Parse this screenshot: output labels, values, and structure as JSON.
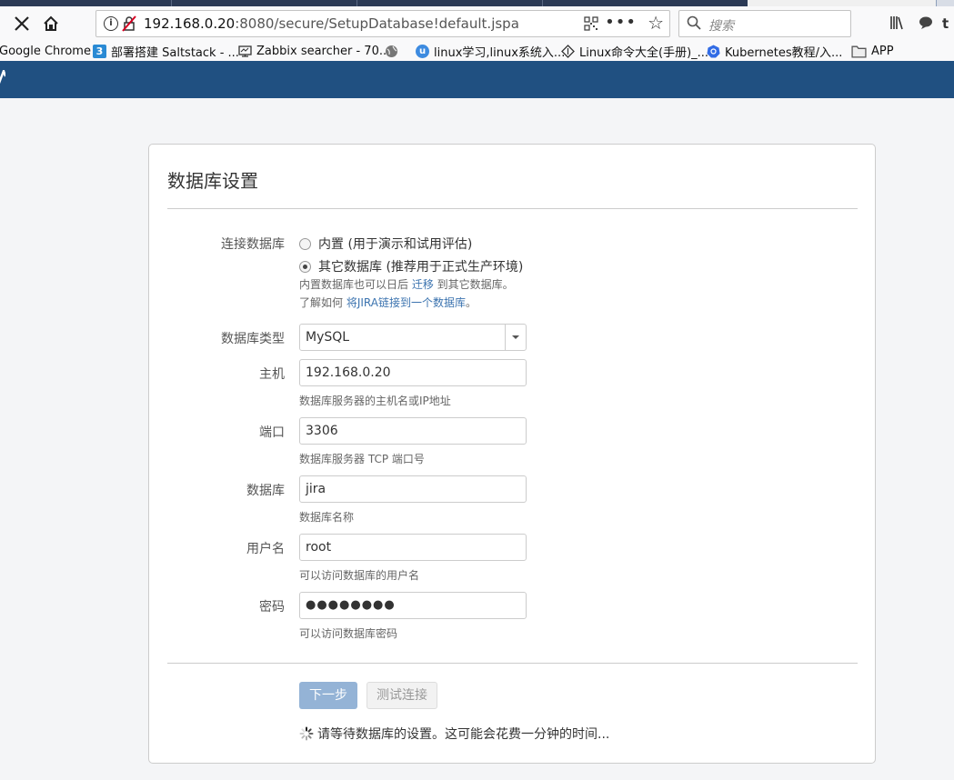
{
  "browser": {
    "url_host": "192.168.0.20",
    "url_rest": ":8080/secure/SetupDatabase!default.jspa",
    "search_placeholder": "搜索",
    "bookmarks": [
      {
        "label": "Google Chrome",
        "icon": "none"
      },
      {
        "label": "部署搭建 Saltstack - ...",
        "icon": "blue-3-icon"
      },
      {
        "label": "Zabbix searcher - 70...",
        "icon": "monitor-icon"
      },
      {
        "label": "",
        "icon": "globe-icon"
      },
      {
        "label": "linux学习,linux系统入...",
        "icon": "blue-circle-icon"
      },
      {
        "label": "Linux命令大全(手册)_...",
        "icon": "diamond-icon"
      },
      {
        "label": "Kubernetes教程/入...",
        "icon": "kubernetes-icon"
      },
      {
        "label": "APP",
        "icon": "folder-icon"
      }
    ]
  },
  "colors": {
    "header": "#205081",
    "primary_button": "#94b3d6",
    "link": "#3b73af"
  },
  "setup": {
    "title": "数据库设置",
    "connection_label": "连接数据库",
    "option_builtin": "内置 (用于演示和试用评估)",
    "option_other": "其它数据库 (推荐用于正式生产环境)",
    "selected_option": "other",
    "note1_before": "内置数据库也可以日后 ",
    "note1_link": "迁移",
    "note1_after": " 到其它数据库。",
    "note2_before": "了解如何 ",
    "note2_link": "将JIRA链接到一个数据库",
    "note2_after": "。",
    "db_type_label": "数据库类型",
    "db_type_value": "MySQL",
    "host_label": "主机",
    "host_value": "192.168.0.20",
    "host_hint": "数据库服务器的主机名或IP地址",
    "port_label": "端口",
    "port_value": "3306",
    "port_hint": "数据库服务器 TCP 端口号",
    "database_label": "数据库",
    "database_value": "jira",
    "database_hint": "数据库名称",
    "username_label": "用户名",
    "username_value": "root",
    "username_hint": "可以访问数据库的用户名",
    "password_label": "密码",
    "password_value": "●●●●●●●●",
    "password_hint": "可以访问数据库密码",
    "next_button": "下一步",
    "test_button": "测试连接",
    "wait_message": "请等待数据库的设置。这可能会花费一分钟的时间..."
  }
}
